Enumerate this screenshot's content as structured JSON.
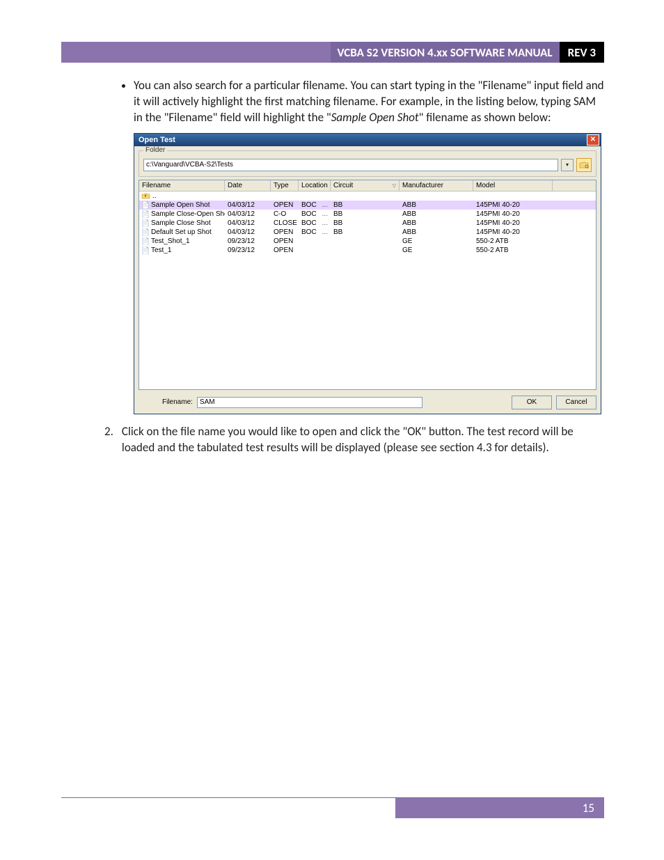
{
  "header": {
    "title": "VCBA S2 VERSION 4.xx SOFTWARE MANUAL",
    "rev": "REV 3"
  },
  "body": {
    "bullet_text_1": "You can also search for a particular filename. You can start typing in the \"Filename\" input field and it will actively highlight the first matching filename. For example, in the listing below, typing SAM in the \"Filename\" field will highlight the \"",
    "bullet_text_italic": "Sample Open Shot",
    "bullet_text_2": "\" filename as shown below:",
    "step2_num": "2.",
    "step2_text": "Click on the file name you would like to open and click the \"OK\" button. The test record will be loaded and the tabulated test results will be displayed (please see section 4.3 for details)."
  },
  "dialog": {
    "title": "Open Test",
    "folder_legend": "Folder",
    "folder_path": "c:\\Vanguard\\VCBA-S2\\Tests",
    "columns": {
      "filename": "Filename",
      "date": "Date",
      "type": "Type",
      "location": "Location",
      "circuit": "Circuit",
      "manufacturer": "Manufacturer",
      "model": "Model"
    },
    "up": "..",
    "rows": [
      {
        "filename": "Sample Open Shot",
        "date": "04/03/12",
        "type": "OPEN",
        "location": "BOC",
        "loc2": "...",
        "circuit": "BB",
        "manufacturer": "ABB",
        "model": "145PMI 40-20",
        "highlight": true
      },
      {
        "filename": "Sample Close-Open Shot",
        "date": "04/03/12",
        "type": "C-O",
        "location": "BOC",
        "loc2": "...",
        "circuit": "BB",
        "manufacturer": "ABB",
        "model": "145PMI 40-20",
        "highlight": false
      },
      {
        "filename": "Sample Close Shot",
        "date": "04/03/12",
        "type": "CLOSE",
        "location": "BOC",
        "loc2": "...",
        "circuit": "BB",
        "manufacturer": "ABB",
        "model": "145PMI 40-20",
        "highlight": false
      },
      {
        "filename": "Default Set up Shot",
        "date": "04/03/12",
        "type": "OPEN",
        "location": "BOC",
        "loc2": "...",
        "circuit": "BB",
        "manufacturer": "ABB",
        "model": "145PMI 40-20",
        "highlight": false
      },
      {
        "filename": "Test_Shot_1",
        "date": "09/23/12",
        "type": "OPEN",
        "location": "",
        "loc2": "",
        "circuit": "",
        "manufacturer": "GE",
        "model": "550-2 ATB",
        "highlight": false
      },
      {
        "filename": "Test_1",
        "date": "09/23/12",
        "type": "OPEN",
        "location": "",
        "loc2": "",
        "circuit": "",
        "manufacturer": "GE",
        "model": "550-2 ATB",
        "highlight": false
      }
    ],
    "filename_label": "Filename:",
    "filename_value": "SAM",
    "ok": "OK",
    "cancel": "Cancel"
  },
  "footer": {
    "page": "15"
  }
}
